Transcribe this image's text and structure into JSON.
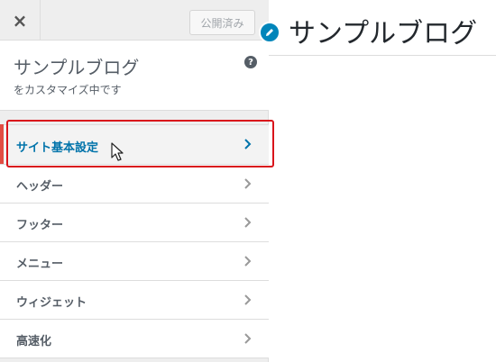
{
  "topbar": {
    "close_label": "×",
    "publish_label": "公開済み"
  },
  "info": {
    "title": "サンプルブログ",
    "subtitle": "をカスタマイズ中です",
    "help": "?"
  },
  "menu": {
    "items": [
      {
        "label": "サイト基本設定",
        "active": true
      },
      {
        "label": "ヘッダー"
      },
      {
        "label": "フッター"
      },
      {
        "label": "メニュー"
      },
      {
        "label": "ウィジェット"
      },
      {
        "label": "高速化"
      }
    ]
  },
  "preview": {
    "site_title": "サンプルブログ"
  },
  "colors": {
    "accent": "#0073aa",
    "highlight": "#d9141b",
    "active_bar": "#e14d43",
    "shortcut": "#0085ba"
  }
}
